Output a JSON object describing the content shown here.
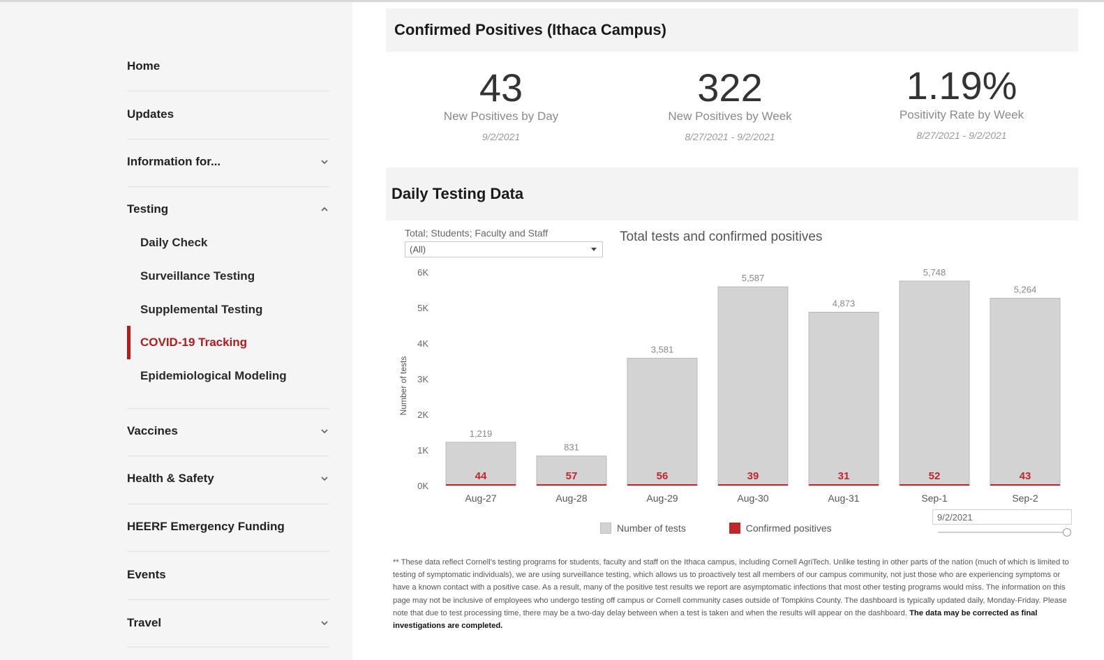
{
  "sidebar": {
    "items": [
      {
        "label": "Home",
        "chevron": "none"
      },
      {
        "label": "Updates",
        "chevron": "none"
      },
      {
        "label": "Information for...",
        "chevron": "down"
      },
      {
        "label": "Testing",
        "chevron": "up"
      },
      {
        "label": "Vaccines",
        "chevron": "down"
      },
      {
        "label": "Health & Safety",
        "chevron": "down"
      },
      {
        "label": "HEERF Emergency Funding",
        "chevron": "none"
      },
      {
        "label": "Events",
        "chevron": "none"
      },
      {
        "label": "Travel",
        "chevron": "down"
      }
    ],
    "testing_subitems": [
      {
        "label": "Daily Check",
        "active": false
      },
      {
        "label": "Surveillance Testing",
        "active": false
      },
      {
        "label": "Supplemental Testing",
        "active": false
      },
      {
        "label": "COVID-19 Tracking",
        "active": true
      },
      {
        "label": "Epidemiological Modeling",
        "active": false
      }
    ]
  },
  "confirmed": {
    "title": "Confirmed Positives (Ithaca Campus)",
    "kpis": [
      {
        "value": "43",
        "caption": "New Positives by Day",
        "date": "9/2/2021"
      },
      {
        "value": "322",
        "caption": "New Positives by Week",
        "date": "8/27/2021 - 9/2/2021"
      },
      {
        "value": "1.19%",
        "caption": "Positivity Rate by Week",
        "date": "8/27/2021 - 9/2/2021"
      }
    ]
  },
  "daily": {
    "title": "Daily Testing Data",
    "filter_label": "Total; Students; Faculty and Staff",
    "filter_value": "(All)",
    "date_value": "9/2/2021"
  },
  "colors": {
    "accent": "#b31b1b",
    "bar_fill": "#d3d3d3",
    "positive": "#c0272d"
  },
  "chart_data": {
    "type": "bar",
    "title": "Total tests and confirmed positives",
    "ylabel": "Number of tests",
    "xlabel": "",
    "categories": [
      "Aug-27",
      "Aug-28",
      "Aug-29",
      "Aug-30",
      "Aug-31",
      "Sep-1",
      "Sep-2"
    ],
    "ylim": [
      0,
      6000
    ],
    "yticks": [
      "0K",
      "1K",
      "2K",
      "3K",
      "4K",
      "5K",
      "6K"
    ],
    "series": [
      {
        "name": "Number of tests",
        "values": [
          1219,
          831,
          3581,
          5587,
          4873,
          5748,
          5264
        ],
        "labels": [
          "1,219",
          "831",
          "3,581",
          "5,587",
          "4,873",
          "5,748",
          "5,264"
        ]
      },
      {
        "name": "Confirmed positives",
        "values": [
          44,
          57,
          56,
          39,
          31,
          52,
          43
        ]
      }
    ],
    "legend": "bottom",
    "grid": false
  },
  "footnote": {
    "text": "** These data reflect Cornell's testing programs for students, faculty and staff on the Ithaca campus, including Cornell AgriTech. Unlike testing in other parts of the nation (much of which is limited to testing of symptomatic individuals), we are using surveillance testing, which allows us to proactively test all members of our campus community, not just those who are experiencing symptoms or have a known contact with a positive case. As a result, many of the positive test results we report are asymptomatic infections that most other testing programs would miss. The information on this page may not be inclusive of employees who undergo testing off campus or Cornell community cases outside of Tompkins County. The dashboard is typically updated daily, Monday-Friday. Please note that due to test processing time, there may be a two-day delay between when a test is taken and when the results will appear on the dashboard. ",
    "bold": "The data may be corrected as final investigations are completed."
  }
}
